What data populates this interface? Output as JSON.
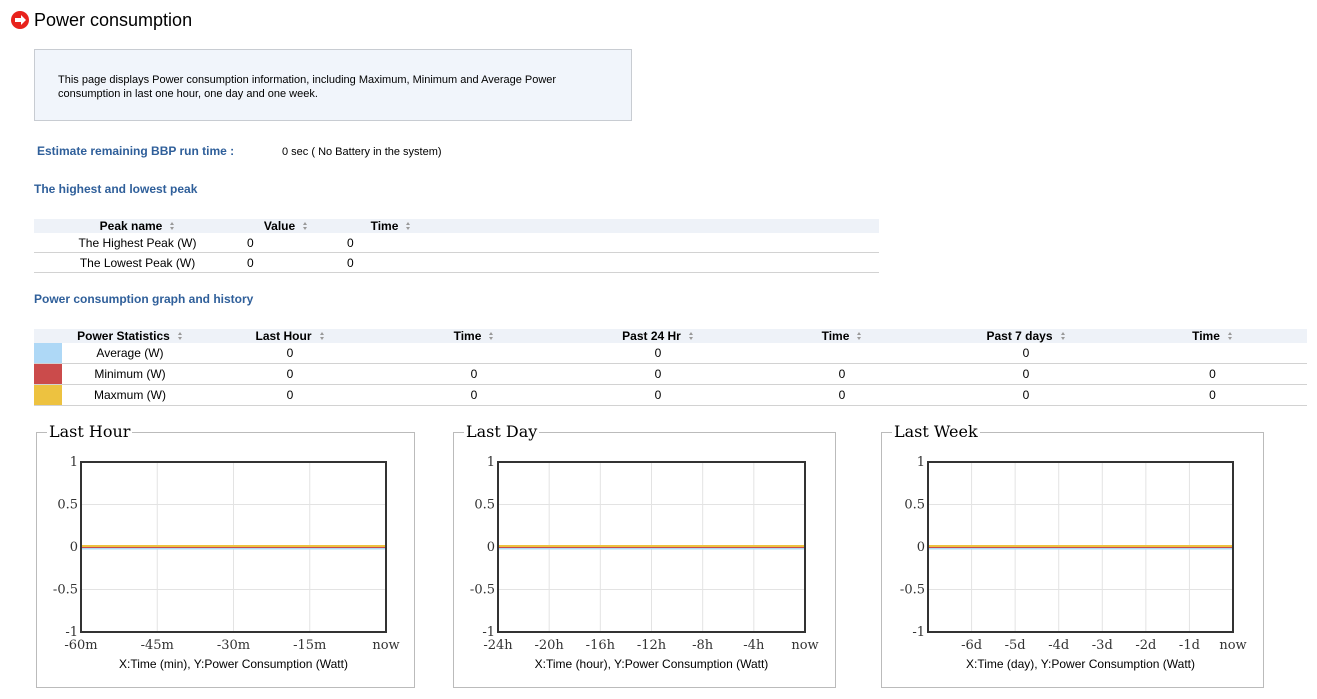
{
  "header": {
    "title": "Power consumption",
    "icon": "arrow-right-circle-icon",
    "icon_color": "#e8221c"
  },
  "description": "This page displays Power consumption information, including Maximum, Minimum and Average Power consumption in last one hour, one day and one week.",
  "bbp": {
    "label": "Estimate remaining BBP run time :",
    "value": "0 sec ( No Battery in the system)"
  },
  "peak_section": {
    "title": "The highest and lowest peak",
    "headers": [
      "Peak name",
      "Value",
      "Time"
    ],
    "rows": [
      {
        "name": "The Highest Peak (W)",
        "value": "0",
        "time": "0"
      },
      {
        "name": "The Lowest Peak (W)",
        "value": "0",
        "time": "0"
      }
    ]
  },
  "history_section": {
    "title": "Power consumption graph and history",
    "headers": [
      "Power Statistics",
      "Last Hour",
      "Time",
      "Past 24 Hr",
      "Time",
      "Past 7 days",
      "Time"
    ],
    "rows": [
      {
        "color": "#aed8f6",
        "name": "Average (W)",
        "last_hour": "0",
        "lh_time": "",
        "past_24": "0",
        "p24_time": "",
        "past_7": "0",
        "p7_time": ""
      },
      {
        "color": "#cb4b4b",
        "name": "Minimum (W)",
        "last_hour": "0",
        "lh_time": "0",
        "past_24": "0",
        "p24_time": "0",
        "past_7": "0",
        "p7_time": "0"
      },
      {
        "color": "#edc240",
        "name": "Maxmum (W)",
        "last_hour": "0",
        "lh_time": "0",
        "past_24": "0",
        "p24_time": "0",
        "past_7": "0",
        "p7_time": "0"
      }
    ]
  },
  "chart_data": [
    {
      "type": "line",
      "title": "Last Hour",
      "xlabel": "X:Time (min), Y:Power Consumption (Watt)",
      "ylim": [
        -1,
        1
      ],
      "yticks": [
        "1",
        "0.5",
        "0",
        "-0.5",
        "-1"
      ],
      "xticks": [
        "-60m",
        "-45m",
        "-30m",
        "-15m",
        "now"
      ],
      "grid": true,
      "series": [
        {
          "color": "#aed8f6",
          "values": [
            0,
            0
          ]
        },
        {
          "color": "#cb4b4b",
          "values": [
            0,
            0
          ]
        },
        {
          "color": "#edc240",
          "values": [
            0,
            0
          ]
        }
      ]
    },
    {
      "type": "line",
      "title": "Last Day",
      "xlabel": "X:Time (hour), Y:Power Consumption (Watt)",
      "ylim": [
        -1,
        1
      ],
      "yticks": [
        "1",
        "0.5",
        "0",
        "-0.5",
        "-1"
      ],
      "xticks": [
        "-24h",
        "-20h",
        "-16h",
        "-12h",
        "-8h",
        "-4h",
        "now"
      ],
      "grid": true,
      "series": [
        {
          "color": "#aed8f6",
          "values": [
            0,
            0
          ]
        },
        {
          "color": "#cb4b4b",
          "values": [
            0,
            0
          ]
        },
        {
          "color": "#edc240",
          "values": [
            0,
            0
          ]
        }
      ]
    },
    {
      "type": "line",
      "title": "Last Week",
      "xlabel": "X:Time (day), Y:Power Consumption (Watt)",
      "ylim": [
        -1,
        1
      ],
      "yticks": [
        "1",
        "0.5",
        "0",
        "-0.5",
        "-1"
      ],
      "xticks": [
        "-6d",
        "-5d",
        "-4d",
        "-3d",
        "-2d",
        "-1d",
        "now"
      ],
      "grid": true,
      "series": [
        {
          "color": "#aed8f6",
          "values": [
            0,
            0
          ]
        },
        {
          "color": "#cb4b4b",
          "values": [
            0,
            0
          ]
        },
        {
          "color": "#edc240",
          "values": [
            0,
            0
          ]
        }
      ]
    }
  ]
}
